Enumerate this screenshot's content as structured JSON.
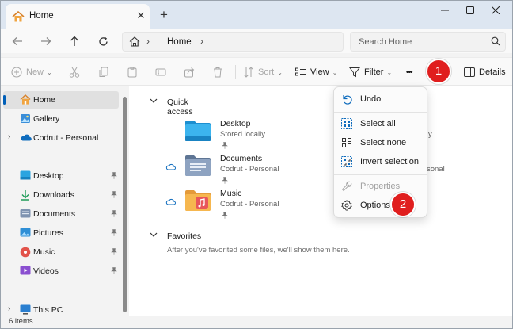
{
  "window": {
    "tab_title": "Home",
    "new_tab_symbol": "+",
    "close_tab_symbol": "✕"
  },
  "address": {
    "crumb": "Home",
    "separator": "›"
  },
  "search": {
    "placeholder": "Search Home"
  },
  "commandbar": {
    "new_label": "New",
    "sort_label": "Sort",
    "view_label": "View",
    "filter_label": "Filter",
    "more_symbol": "•••",
    "details_label": "Details",
    "dropdown_symbol": "⌄"
  },
  "nav": {
    "items": [
      {
        "label": "Home",
        "icon": "home-icon"
      },
      {
        "label": "Gallery",
        "icon": "gallery-icon"
      },
      {
        "label": "Codrut - Personal",
        "icon": "onedrive-icon"
      },
      {
        "label": "Desktop",
        "icon": "desktop-folder-icon"
      },
      {
        "label": "Downloads",
        "icon": "downloads-icon"
      },
      {
        "label": "Documents",
        "icon": "documents-folder-icon"
      },
      {
        "label": "Pictures",
        "icon": "pictures-folder-icon"
      },
      {
        "label": "Music",
        "icon": "music-folder-icon"
      },
      {
        "label": "Videos",
        "icon": "videos-folder-icon"
      },
      {
        "label": "This PC",
        "icon": "this-pc-icon"
      }
    ],
    "expand_symbol": "›"
  },
  "main": {
    "quick_access_title": "Quick access",
    "favorites_title": "Favorites",
    "favorites_empty": "After you've favorited some files, we'll show them here.",
    "quick_access": [
      {
        "name": "Desktop",
        "sub": "Stored locally"
      },
      {
        "name": "Documents",
        "sub": "Codrut - Personal"
      },
      {
        "name": "Music",
        "sub": "Codrut - Personal"
      }
    ],
    "peek_1": "y",
    "peek_2": "sonal"
  },
  "menu": {
    "items": [
      {
        "label": "Undo",
        "icon": "undo-icon",
        "enabled": true
      },
      {
        "label": "Select all",
        "icon": "select-all-icon",
        "enabled": true
      },
      {
        "label": "Select none",
        "icon": "select-none-icon",
        "enabled": true
      },
      {
        "label": "Invert selection",
        "icon": "invert-selection-icon",
        "enabled": true
      },
      {
        "label": "Properties",
        "icon": "properties-wrench-icon",
        "enabled": false
      },
      {
        "label": "Options",
        "icon": "options-gear-icon",
        "enabled": true
      }
    ]
  },
  "markers": {
    "one": "1",
    "two": "2"
  },
  "status": {
    "items_count": "6 items"
  },
  "colors": {
    "accent": "#005fb8",
    "marker": "#e01e1e",
    "folder_blue": "#2aa4e0",
    "onedrive": "#0f6cbd"
  }
}
